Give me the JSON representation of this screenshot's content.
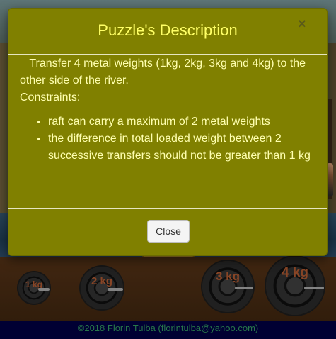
{
  "modal": {
    "title": "Puzzle's Description",
    "close_symbol": "×",
    "intro": "Transfer 4 metal weights (1kg, 2kg, 3kg and 4kg) to the other side of the river.",
    "constraints_heading": "Constraints:",
    "constraints": [
      "raft can carry a maximum of 2 metal weights",
      "the difference in total loaded weight between 2 successive transfers should not be greater than 1 kg"
    ],
    "close_button": "Close"
  },
  "weights": [
    {
      "label": "1 kg",
      "kg": 1
    },
    {
      "label": "2 kg",
      "kg": 2
    },
    {
      "label": "3 kg",
      "kg": 3
    },
    {
      "label": "4 kg",
      "kg": 4
    }
  ],
  "footer": {
    "credit": "©2018 Florin Tulba (florintulba@yahoo.com)"
  },
  "colors": {
    "modal_background": "#808000",
    "title_text": "#ffff66",
    "body_text": "#ffffb0",
    "weight_label": "#a0522d",
    "footer_background": "#00003c",
    "footer_text": "#2e8b57"
  }
}
